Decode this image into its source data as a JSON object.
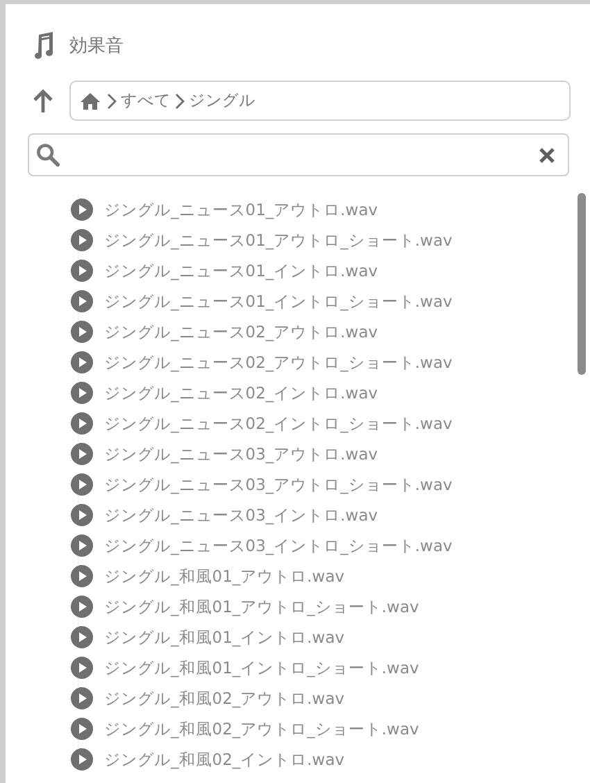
{
  "header": {
    "title": "効果音"
  },
  "breadcrumb": [
    {
      "label": "すべて"
    },
    {
      "label": "ジングル"
    }
  ],
  "files": [
    {
      "name": "ジングル_ニュース01_アウトロ.wav"
    },
    {
      "name": "ジングル_ニュース01_アウトロ_ショート.wav"
    },
    {
      "name": "ジングル_ニュース01_イントロ.wav"
    },
    {
      "name": "ジングル_ニュース01_イントロ_ショート.wav"
    },
    {
      "name": "ジングル_ニュース02_アウトロ.wav"
    },
    {
      "name": "ジングル_ニュース02_アウトロ_ショート.wav"
    },
    {
      "name": "ジングル_ニュース02_イントロ.wav"
    },
    {
      "name": "ジングル_ニュース02_イントロ_ショート.wav"
    },
    {
      "name": "ジングル_ニュース03_アウトロ.wav"
    },
    {
      "name": "ジングル_ニュース03_アウトロ_ショート.wav"
    },
    {
      "name": "ジングル_ニュース03_イントロ.wav"
    },
    {
      "name": "ジングル_ニュース03_イントロ_ショート.wav"
    },
    {
      "name": "ジングル_和風01_アウトロ.wav"
    },
    {
      "name": "ジングル_和風01_アウトロ_ショート.wav"
    },
    {
      "name": "ジングル_和風01_イントロ.wav"
    },
    {
      "name": "ジングル_和風01_イントロ_ショート.wav"
    },
    {
      "name": "ジングル_和風02_アウトロ.wav"
    },
    {
      "name": "ジングル_和風02_アウトロ_ショート.wav"
    },
    {
      "name": "ジングル_和風02_イントロ.wav"
    }
  ]
}
